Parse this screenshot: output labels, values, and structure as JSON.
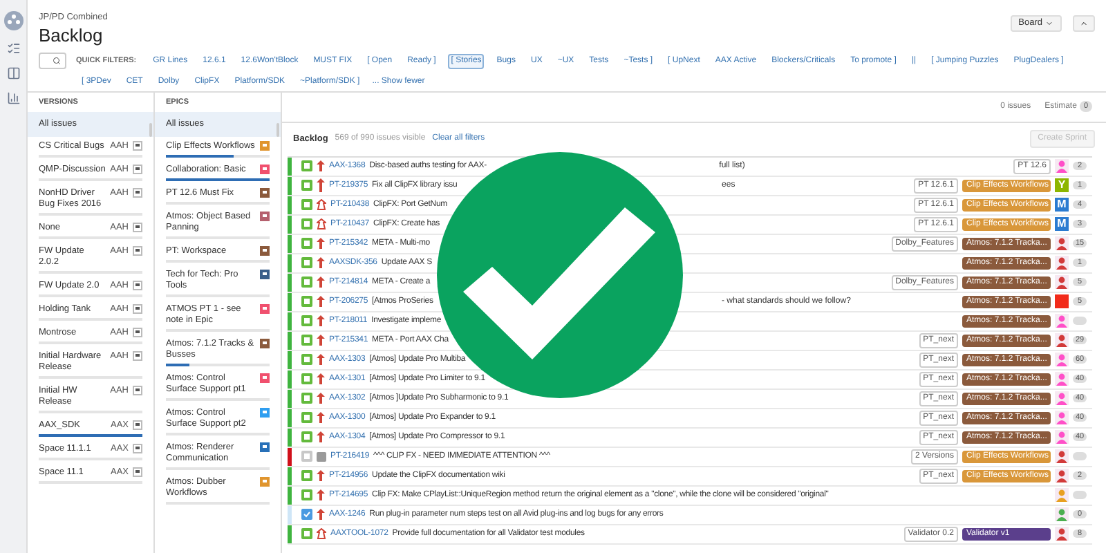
{
  "header": {
    "project": "JP/PD Combined",
    "title": "Backlog",
    "board_button": "Board"
  },
  "quick_filters": {
    "label": "QUICK FILTERS:",
    "filters": [
      {
        "label": "GR Lines",
        "selected": false
      },
      {
        "label": "12.6.1",
        "selected": false
      },
      {
        "label": "12.6Won'tBlock",
        "selected": false
      },
      {
        "label": "MUST FIX",
        "selected": false
      },
      {
        "label": "[ Open",
        "selected": false
      },
      {
        "label": "Ready ]",
        "selected": false
      },
      {
        "label": "[ Stories",
        "selected": true
      },
      {
        "label": "Bugs",
        "selected": false
      },
      {
        "label": "UX",
        "selected": false
      },
      {
        "label": "~UX",
        "selected": false
      },
      {
        "label": "Tests",
        "selected": false
      },
      {
        "label": "~Tests ]",
        "selected": false
      },
      {
        "label": "[ UpNext",
        "selected": false
      },
      {
        "label": "AAX Active",
        "selected": false
      },
      {
        "label": "Blockers/Criticals",
        "selected": false
      },
      {
        "label": "To promote ]",
        "selected": false
      },
      {
        "label": "||",
        "selected": false
      },
      {
        "label": "[ Jumping Puzzles",
        "selected": false
      },
      {
        "label": "PlugDealers ]",
        "selected": false
      },
      {
        "label": "[ 3PDev",
        "selected": false
      },
      {
        "label": "CET",
        "selected": false
      },
      {
        "label": "Dolby",
        "selected": false
      },
      {
        "label": "ClipFX",
        "selected": false
      },
      {
        "label": "Platform/SDK",
        "selected": false
      },
      {
        "label": "~Platform/SDK ]",
        "selected": false
      }
    ],
    "show_fewer": "... Show fewer"
  },
  "versions": {
    "heading": "VERSIONS",
    "all": {
      "label": "All issues",
      "selected": true
    },
    "items": [
      {
        "name": "CS Critical Bugs",
        "project": "AAH",
        "level": 0
      },
      {
        "name": "QMP-Discussion",
        "project": "AAH",
        "level": 0
      },
      {
        "name": "NonHD Driver Bug Fixes 2016",
        "project": "AAH",
        "level": 0
      },
      {
        "name": "None",
        "project": "AAH",
        "level": 0
      },
      {
        "name": "FW Update 2.0.2",
        "project": "AAH",
        "level": 0
      },
      {
        "name": "FW Update 2.0",
        "project": "AAH",
        "level": 0
      },
      {
        "name": "Holding Tank",
        "project": "AAH",
        "level": 0
      },
      {
        "name": "Montrose",
        "project": "AAH",
        "level": 0
      },
      {
        "name": "Initial Hardware Release",
        "project": "AAH",
        "level": 0
      },
      {
        "name": "Initial HW Release",
        "project": "AAH",
        "level": 0
      },
      {
        "name": "AAX_SDK",
        "project": "AAX",
        "level": 1
      },
      {
        "name": "Space 11.1.1",
        "project": "AAX",
        "level": 0
      },
      {
        "name": "Space 11.1",
        "project": "AAX",
        "level": 0
      }
    ]
  },
  "epics": {
    "heading": "EPICS",
    "all": {
      "label": "All issues",
      "selected": true
    },
    "items": [
      {
        "name": "Clip Effects Workflows",
        "color": "#e0952e",
        "level": 0.65
      },
      {
        "name": "Collaboration: Basic",
        "color": "#f0506e",
        "level": 1
      },
      {
        "name": "PT 12.6 Must Fix",
        "color": "#8b5a3c",
        "level": 0
      },
      {
        "name": "Atmos: Object Based Panning",
        "color": "#b5606e",
        "level": 0
      },
      {
        "name": "PT: Workspace",
        "color": "#8b5a3c",
        "level": 0
      },
      {
        "name": "Tech for Tech: Pro Tools",
        "color": "#3b5f8a",
        "level": 0
      },
      {
        "name": "ATMOS PT 1 - see note in Epic",
        "color": "#f0506e",
        "level": 0
      },
      {
        "name": "Atmos: 7.1.2 Tracks & Busses",
        "color": "#8b5a3c",
        "level": 0.22
      },
      {
        "name": "Atmos: Control Surface Support pt1",
        "color": "#f0506e",
        "level": 0
      },
      {
        "name": "Atmos: Control Surface Support pt2",
        "color": "#2f9ef0",
        "level": 0
      },
      {
        "name": "Atmos: Renderer Communication",
        "color": "#2870b8",
        "level": 0
      },
      {
        "name": "Atmos: Dubber Workflows",
        "color": "#e0952e",
        "level": 0
      }
    ]
  },
  "summary": {
    "issues": "0 issues",
    "estimate_label": "Estimate",
    "estimate": "0"
  },
  "backlog": {
    "title": "Backlog",
    "count": "569 of 990 issues visible",
    "clear": "Clear all filters",
    "create_button": "Create Sprint",
    "rows": [
      {
        "kind": "story",
        "priority": {
          "kind": "high"
        },
        "color": "#3fb43f",
        "key": "AAX-1368",
        "summary": "Disc-based auths testing for AAX-",
        "tail": "full list)",
        "labels": [
          "PT 12.6"
        ],
        "avatar": {
          "kind": "picture",
          "color": "#ff4fc8"
        },
        "estimate": "2"
      },
      {
        "kind": "story",
        "priority": {
          "kind": "highest"
        },
        "color": "#3fb43f",
        "key": "PT-219375",
        "summary": "Fix all ClipFX library issu",
        "tail": "ees",
        "labels": [
          "PT 12.6.1"
        ],
        "epic": {
          "name": "Clip Effects Workflows",
          "color": "#d9973a"
        },
        "avatar": {
          "kind": "letter",
          "color": "#8db600",
          "text": "Y"
        },
        "estimate": "1"
      },
      {
        "kind": "story",
        "priority": {
          "kind": "blocker"
        },
        "color": "#3fb43f",
        "key": "PT-210438",
        "summary": "ClipFX: Port GetNum",
        "labels": [
          "PT 12.6.1"
        ],
        "epic": {
          "name": "Clip Effects Workflows",
          "color": "#d9973a"
        },
        "avatar": {
          "kind": "letter",
          "color": "#2b7bd0",
          "text": "M"
        },
        "estimate": "4"
      },
      {
        "kind": "story",
        "priority": {
          "kind": "blocker"
        },
        "color": "#3fb43f",
        "key": "PT-210437",
        "summary": "ClipFX: Create has",
        "labels": [
          "PT 12.6.1"
        ],
        "epic": {
          "name": "Clip Effects Workflows",
          "color": "#d9973a"
        },
        "avatar": {
          "kind": "letter",
          "color": "#2b7bd0",
          "text": "M"
        },
        "estimate": "3"
      },
      {
        "kind": "story",
        "priority": {
          "kind": "high"
        },
        "color": "#3fb43f",
        "key": "PT-215342",
        "summary": "META - Multi-mo",
        "labels": [
          "Dolby_Features"
        ],
        "epic": {
          "name": "Atmos: 7.1.2 Tracka...",
          "color": "#8b5a3c"
        },
        "avatar": {
          "kind": "picture",
          "color": "#d23a3a"
        },
        "estimate": "15"
      },
      {
        "kind": "story",
        "priority": {
          "kind": "high"
        },
        "color": "#3fb43f",
        "key": "AAXSDK-356",
        "summary": "Update AAX S",
        "labels": [],
        "epic": {
          "name": "Atmos: 7.1.2 Tracka...",
          "color": "#8b5a3c"
        },
        "avatar": {
          "kind": "picture",
          "color": "#d23a3a"
        },
        "estimate": "1"
      },
      {
        "kind": "story",
        "priority": {
          "kind": "high"
        },
        "color": "#3fb43f",
        "key": "PT-214814",
        "summary": "META - Create a",
        "labels": [
          "Dolby_Features"
        ],
        "epic": {
          "name": "Atmos: 7.1.2 Tracka...",
          "color": "#8b5a3c"
        },
        "avatar": {
          "kind": "picture",
          "color": "#d23a3a"
        },
        "estimate": "5"
      },
      {
        "kind": "story",
        "priority": {
          "kind": "high"
        },
        "color": "#3fb43f",
        "key": "PT-206275",
        "summary": "[Atmos ProSeries",
        "tail": "- what standards should we follow?",
        "labels": [],
        "epic": {
          "name": "Atmos: 7.1.2 Tracka...",
          "color": "#8b5a3c"
        },
        "avatar": {
          "kind": "block",
          "color": "#f22b1a"
        },
        "estimate": "5"
      },
      {
        "kind": "story",
        "priority": {
          "kind": "high"
        },
        "color": "#3fb43f",
        "key": "PT-218011",
        "summary": "Investigate impleme",
        "labels": [],
        "epic": {
          "name": "Atmos: 7.1.2 Tracka...",
          "color": "#8b5a3c"
        },
        "avatar": {
          "kind": "picture",
          "color": "#ff4fc8"
        }
      },
      {
        "kind": "story",
        "priority": {
          "kind": "high"
        },
        "color": "#3fb43f",
        "key": "PT-215341",
        "summary": "META - Port AAX Cha",
        "labels": [
          "PT_next"
        ],
        "epic": {
          "name": "Atmos: 7.1.2 Tracka...",
          "color": "#8b5a3c"
        },
        "avatar": {
          "kind": "picture",
          "color": "#d23a3a"
        },
        "estimate": "29"
      },
      {
        "kind": "story",
        "priority": {
          "kind": "high"
        },
        "color": "#3fb43f",
        "key": "AAX-1303",
        "summary": "[Atmos] Update Pro Multiba",
        "labels": [
          "PT_next"
        ],
        "epic": {
          "name": "Atmos: 7.1.2 Tracka...",
          "color": "#8b5a3c"
        },
        "avatar": {
          "kind": "picture",
          "color": "#ff4fc8"
        },
        "estimate": "60"
      },
      {
        "kind": "story",
        "priority": {
          "kind": "high"
        },
        "color": "#3fb43f",
        "key": "AAX-1301",
        "summary": "[Atmos] Update Pro Limiter to 9.1",
        "labels": [
          "PT_next"
        ],
        "epic": {
          "name": "Atmos: 7.1.2 Tracka...",
          "color": "#8b5a3c"
        },
        "avatar": {
          "kind": "picture",
          "color": "#ff4fc8"
        },
        "estimate": "40"
      },
      {
        "kind": "story",
        "priority": {
          "kind": "high"
        },
        "color": "#3fb43f",
        "key": "AAX-1302",
        "summary": "[Atmos ]Update Pro Subharmonic to 9.1",
        "labels": [
          "PT_next"
        ],
        "epic": {
          "name": "Atmos: 7.1.2 Tracka...",
          "color": "#8b5a3c"
        },
        "avatar": {
          "kind": "picture",
          "color": "#ff4fc8"
        },
        "estimate": "40"
      },
      {
        "kind": "story",
        "priority": {
          "kind": "high"
        },
        "color": "#3fb43f",
        "key": "AAX-1300",
        "summary": "[Atmos] Update Pro Expander to 9.1",
        "labels": [
          "PT_next"
        ],
        "epic": {
          "name": "Atmos: 7.1.2 Tracka...",
          "color": "#8b5a3c"
        },
        "avatar": {
          "kind": "picture",
          "color": "#ff4fc8"
        },
        "estimate": "40"
      },
      {
        "kind": "story",
        "priority": {
          "kind": "high"
        },
        "color": "#3fb43f",
        "key": "AAX-1304",
        "summary": "[Atmos] Update Pro Compressor to 9.1",
        "labels": [
          "PT_next"
        ],
        "epic": {
          "name": "Atmos: 7.1.2 Tracka...",
          "color": "#8b5a3c"
        },
        "avatar": {
          "kind": "picture",
          "color": "#ff4fc8"
        },
        "estimate": "40"
      },
      {
        "kind": "epic",
        "priority": {
          "kind": "unknown"
        },
        "color": "#d0101a",
        "key": "PT-216419",
        "summary": "^^^ CLIP FX - NEED IMMEDIATE ATTENTION ^^^",
        "labels": [
          "2 Versions"
        ],
        "epic": {
          "name": "Clip Effects Workflows",
          "color": "#d9973a"
        },
        "avatar": {
          "kind": "picture",
          "color": "#d23a3a"
        }
      },
      {
        "kind": "story",
        "priority": {
          "kind": "high"
        },
        "color": "#3fb43f",
        "key": "PT-214956",
        "summary": "Update the ClipFX documentation wiki",
        "labels": [
          "PT_next"
        ],
        "epic": {
          "name": "Clip Effects Workflows",
          "color": "#d9973a"
        },
        "avatar": {
          "kind": "picture",
          "color": "#d23a3a"
        },
        "estimate": "2"
      },
      {
        "kind": "story",
        "priority": {
          "kind": "high"
        },
        "color": "#3fb43f",
        "key": "PT-214695",
        "summary": "Clip FX: Make CPlayList::UniqueRegion method return the original element as a \"clone\", while the clone will be considered \"original\"",
        "labels": [],
        "avatar": {
          "kind": "picture",
          "color": "#e8a020"
        }
      },
      {
        "kind": "task",
        "priority": {
          "kind": "high"
        },
        "color": "#cfe6f7",
        "key": "AAX-1246",
        "summary": "Run plug-in parameter num steps test on all Avid plug-ins and log bugs for any errors",
        "labels": [],
        "avatar": {
          "kind": "picture",
          "color": "#4caf50"
        },
        "estimate": "0"
      },
      {
        "kind": "story",
        "priority": {
          "kind": "blocker"
        },
        "color": "#3fb43f",
        "key": "AAXTOOL-1072",
        "summary": "Provide full documentation for all Validator test modules",
        "labels": [
          "Validator 0.2"
        ],
        "epic": {
          "name": "Validator v1",
          "color": "#5b3f8c"
        },
        "avatar": {
          "kind": "picture",
          "color": "#d23a3a"
        },
        "estimate": "8"
      }
    ]
  }
}
